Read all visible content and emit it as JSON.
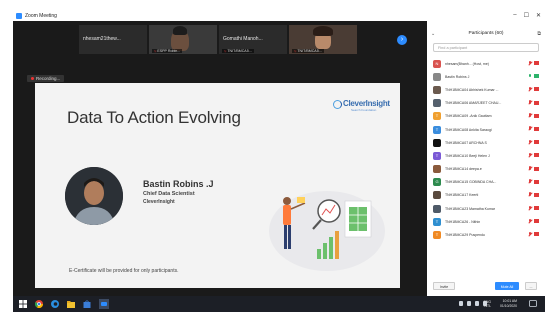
{
  "window": {
    "title": "Zoom Meeting"
  },
  "thumbnails": [
    {
      "name": "nhesam21thew...",
      "label": ""
    },
    {
      "name": "",
      "label": "ESPP Robin..."
    },
    {
      "name": "Gomathi  Manoh...",
      "label": "TNIT/BMCA5..."
    },
    {
      "name": "",
      "label": "TNIT/BMCA5..."
    }
  ],
  "recording_label": "Recording...",
  "slide": {
    "title": "Data To Action Evolving",
    "logo_name": "CleverInsight",
    "logo_sub": "Search Foundation",
    "speaker_name": "Bastin Robins .J",
    "speaker_role": "Chief Data Scientist",
    "speaker_org": "CleverInsight",
    "certificate_note": "E-Certificate will be provided for only participants."
  },
  "participants_panel": {
    "title": "Participants (60)",
    "search_placeholder": "Find a participant",
    "participants": [
      {
        "initial": "N",
        "name": "nhesam(Bhanh... (Host, me)",
        "color": "#d9534f",
        "mic_on": false,
        "video_on": false
      },
      {
        "initial": "",
        "name": "Bastin Robins J",
        "color": "#888888",
        "mic_on": true,
        "video_on": true
      },
      {
        "initial": "",
        "name": "TNH1BMCA04 Abhishek Kumar ...",
        "color": "#6b5a4e",
        "mic_on": false,
        "video_on": false
      },
      {
        "initial": "",
        "name": "TNH1BMCA06 AMARJEET CHAU...",
        "color": "#55606d",
        "mic_on": false,
        "video_on": false
      },
      {
        "initial": "T",
        "name": "TNH1BMCA09 -Anik Gauttam",
        "color": "#f0a030",
        "mic_on": false,
        "video_on": false
      },
      {
        "initial": "T",
        "name": "TNH1BMCA08 Ankita Saraogi",
        "color": "#3a8dde",
        "mic_on": false,
        "video_on": false
      },
      {
        "initial": "",
        "name": "TNH1BMCA07 ARCHNA S",
        "color": "#111111",
        "mic_on": false,
        "video_on": false
      },
      {
        "initial": "T",
        "name": "TNH1BMCA10 Beeji Helen J",
        "color": "#7b5ad6",
        "mic_on": false,
        "video_on": false
      },
      {
        "initial": "",
        "name": "TNH1BMCA14 deepa.e",
        "color": "#8a5a3c",
        "mic_on": false,
        "video_on": false
      },
      {
        "initial": "G",
        "name": "TNH1BMCA15 GOBINDA CHA...",
        "color": "#2d8a4e",
        "mic_on": false,
        "video_on": false
      },
      {
        "initial": "",
        "name": "TNH1BMCA17 Keerti",
        "color": "#5a4a3e",
        "mic_on": false,
        "video_on": false
      },
      {
        "initial": "",
        "name": "TNH1BMCA23 Mamatha Kumar",
        "color": "#4e5a68",
        "mic_on": false,
        "video_on": false
      },
      {
        "initial": "T",
        "name": "TNH1BMCA26 - Nithin",
        "color": "#2f8fd0",
        "mic_on": false,
        "video_on": false
      },
      {
        "initial": "T",
        "name": "TNH1BMCA29 Puspendu",
        "color": "#f08a24",
        "mic_on": false,
        "video_on": false
      }
    ],
    "invite_label": "Invite",
    "mute_all_label": "Mute All",
    "more_label": "..."
  },
  "taskbar": {
    "lang": "ENG",
    "lang_sub": "INTL",
    "time": "10:01 AM",
    "date": "01/10/2020"
  },
  "colors": {
    "zoom_blue": "#2d8cff",
    "muted_red": "#e03a3a",
    "active_green": "#2db36b"
  }
}
